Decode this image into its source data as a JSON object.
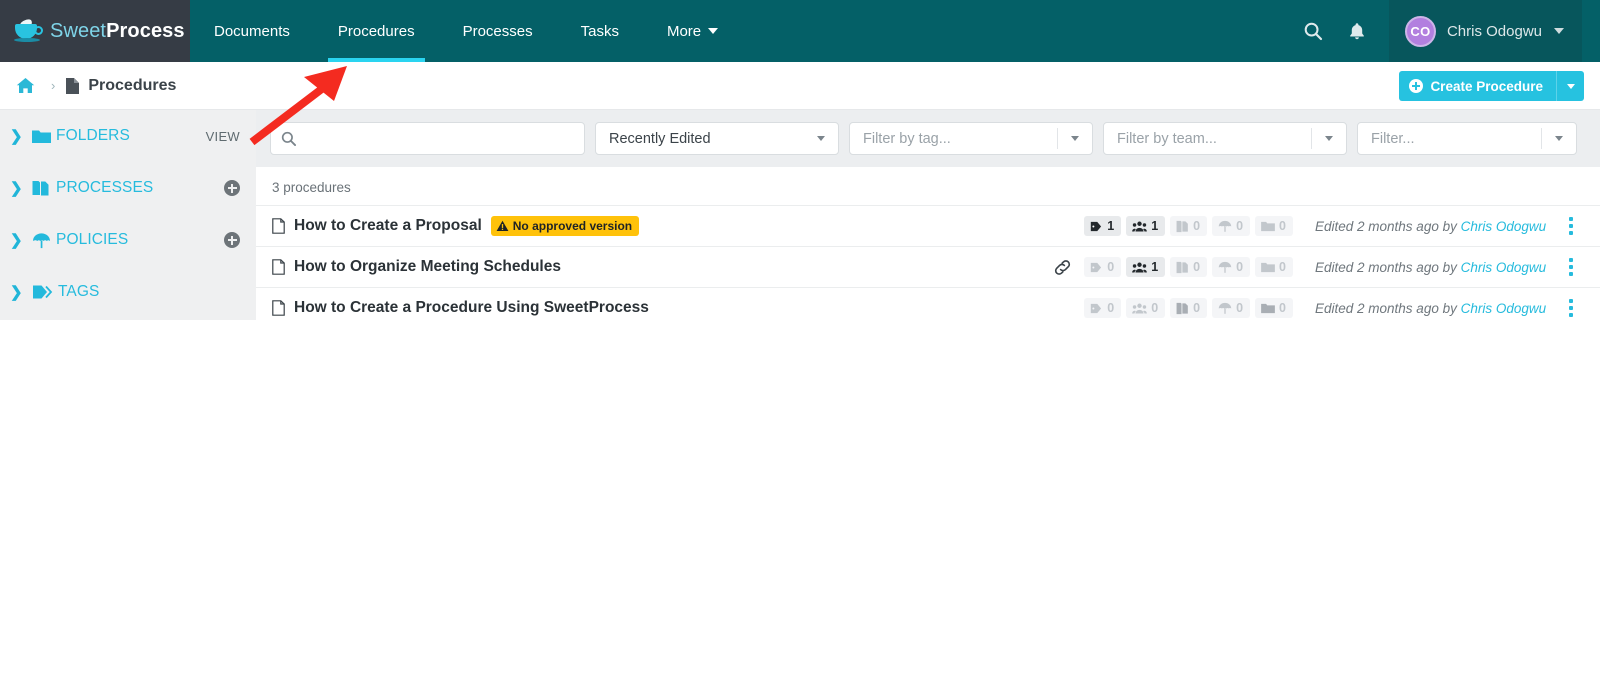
{
  "brand": {
    "name_light": "Sweet",
    "name_bold": "Process",
    "logo_icon": "teacup-icon",
    "accent_color": "#26bbdd",
    "header_color": "#046067",
    "logo_bg_color": "#363c45"
  },
  "topnav": {
    "items": [
      {
        "label": "Documents",
        "active": false,
        "has_caret": false
      },
      {
        "label": "Procedures",
        "active": true,
        "has_caret": false
      },
      {
        "label": "Processes",
        "active": false,
        "has_caret": false
      },
      {
        "label": "Tasks",
        "active": false,
        "has_caret": false
      },
      {
        "label": "More",
        "active": false,
        "has_caret": true
      }
    ],
    "search_icon": "search-icon",
    "bell_icon": "bell-icon",
    "user": {
      "initials": "CO",
      "name": "Chris Odogwu",
      "avatar_color": "#b27fdf"
    }
  },
  "breadcrumb": {
    "home_icon": "home-icon",
    "separator": "›",
    "doc_icon": "document-icon",
    "label": "Procedures"
  },
  "actions": {
    "create_label": "Create Procedure",
    "create_color": "#26c2e0"
  },
  "sidebar": {
    "items": [
      {
        "label": "FOLDERS",
        "icon": "folder-icon",
        "action": "VIEW",
        "action_type": "text"
      },
      {
        "label": "PROCESSES",
        "icon": "processes-icon",
        "action": "",
        "action_type": "plus"
      },
      {
        "label": "POLICIES",
        "icon": "umbrella-icon",
        "action": "",
        "action_type": "plus"
      },
      {
        "label": "TAGS",
        "icon": "tag-icon",
        "action": "",
        "action_type": "none"
      }
    ]
  },
  "filters": {
    "search_placeholder": "",
    "search_value": "",
    "search_icon": "search-icon",
    "sort_value": "Recently Edited",
    "sort_options": [
      "Recently Edited"
    ],
    "tag_placeholder": "Filter by tag...",
    "team_placeholder": "Filter by team...",
    "misc_placeholder": "Filter..."
  },
  "list": {
    "count_label": "3 procedures",
    "stat_icons": [
      "tag-icon",
      "team-icon",
      "processes-icon",
      "umbrella-icon",
      "folder-icon"
    ],
    "rows": [
      {
        "title": "How to Create a Proposal",
        "badge": "No approved version",
        "badge_color": "#ffc20a",
        "has_link_icon": false,
        "stats": [
          "1",
          "1",
          "0",
          "0",
          "0"
        ],
        "edited_prefix": "Edited 2 months ago by ",
        "edited_author": "Chris Odogwu"
      },
      {
        "title": "How to Organize Meeting Schedules",
        "badge": "",
        "badge_color": "",
        "has_link_icon": true,
        "stats": [
          "0",
          "1",
          "0",
          "0",
          "0"
        ],
        "edited_prefix": "Edited 2 months ago by ",
        "edited_author": "Chris Odogwu"
      },
      {
        "title": "How to Create a Procedure Using SweetProcess",
        "badge": "",
        "badge_color": "",
        "has_link_icon": false,
        "stats": [
          "0",
          "0",
          "0",
          "0",
          "0"
        ],
        "edited_prefix": "Edited 2 months ago by ",
        "edited_author": "Chris Odogwu"
      }
    ]
  },
  "annotation": {
    "type": "arrow",
    "color": "#f42b20",
    "points_to": "Procedures"
  }
}
